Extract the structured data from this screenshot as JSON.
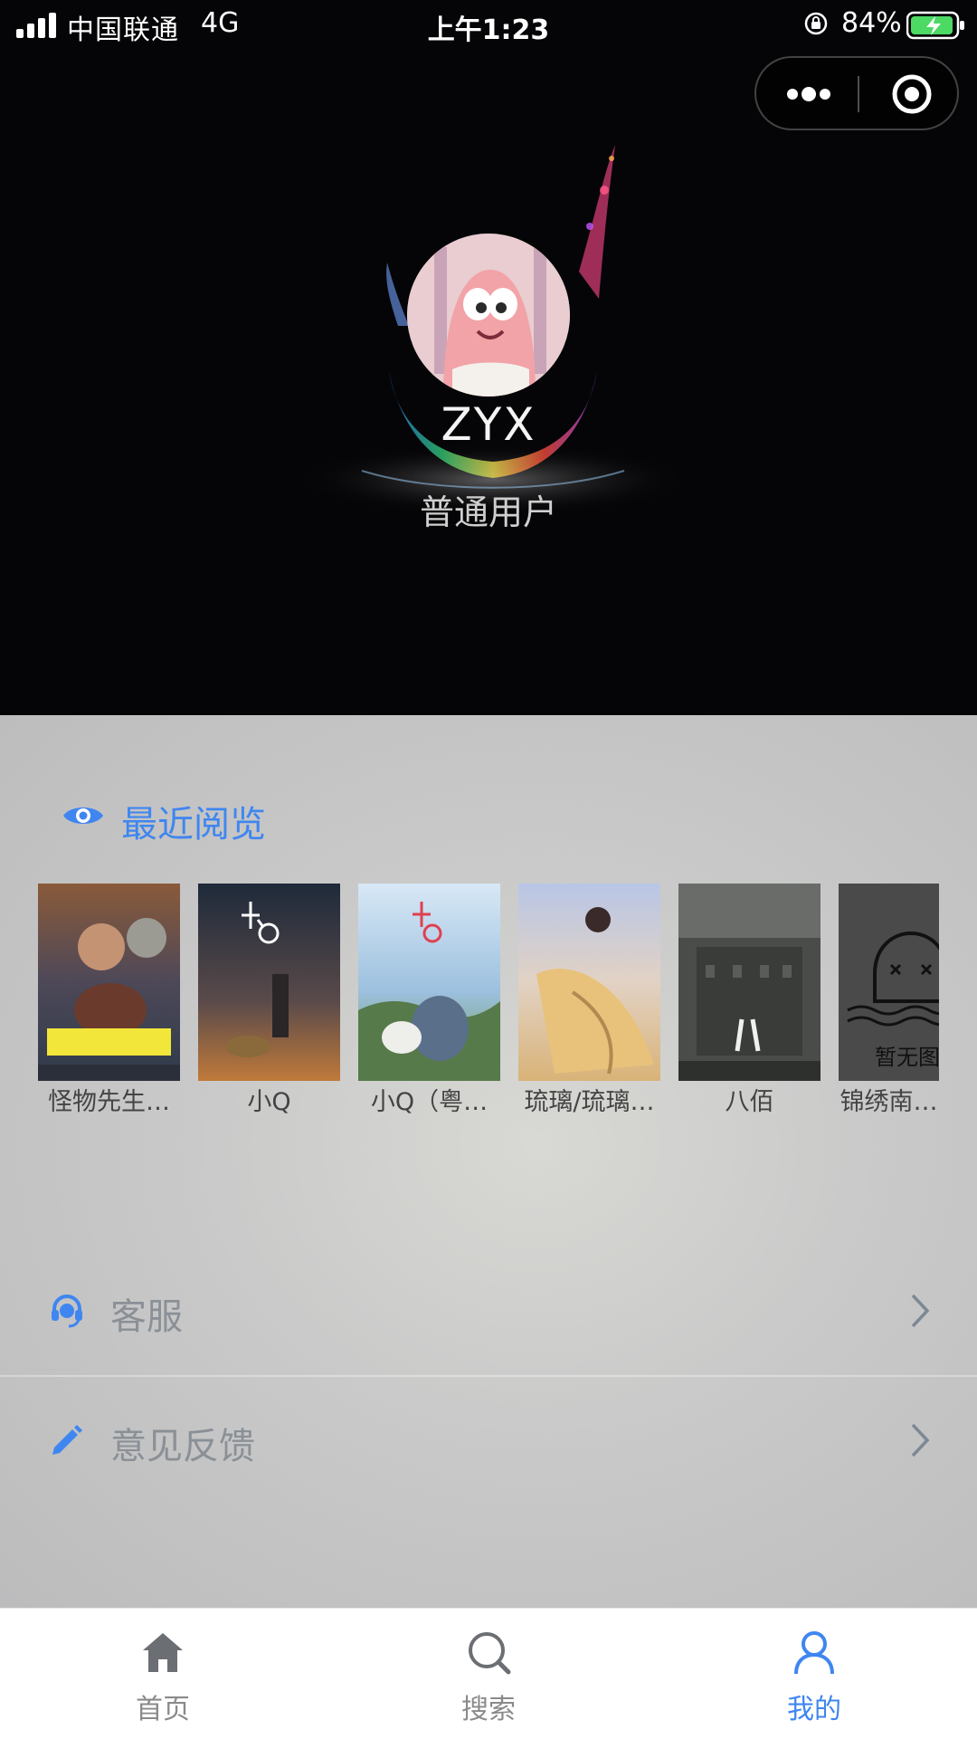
{
  "status_bar": {
    "carrier": "中国联通",
    "network": "4G",
    "time": "上午1:23",
    "battery": "84%"
  },
  "header": {
    "username": "ZYX",
    "role": "普通用户"
  },
  "recent": {
    "title": "最近阅览",
    "items": [
      {
        "title": "怪物先生…"
      },
      {
        "title": "小Q"
      },
      {
        "title": "小Q（粤…"
      },
      {
        "title": "琉璃/琉璃…"
      },
      {
        "title": "八佰"
      },
      {
        "title": "锦绣南…"
      }
    ],
    "placeholder_text": "暂无图片"
  },
  "menu": {
    "customer_service": "客服",
    "feedback": "意见反馈"
  },
  "tabbar": {
    "home": "首页",
    "search": "搜索",
    "mine": "我的"
  },
  "colors": {
    "accent": "#3f86f0",
    "header_bg": "#050507",
    "menu_text": "#8a9096"
  },
  "icons": [
    "eye-icon",
    "headset-icon",
    "pencil-icon",
    "chevron-right-icon",
    "home-icon",
    "search-icon",
    "user-icon",
    "more-icon",
    "target-icon"
  ]
}
